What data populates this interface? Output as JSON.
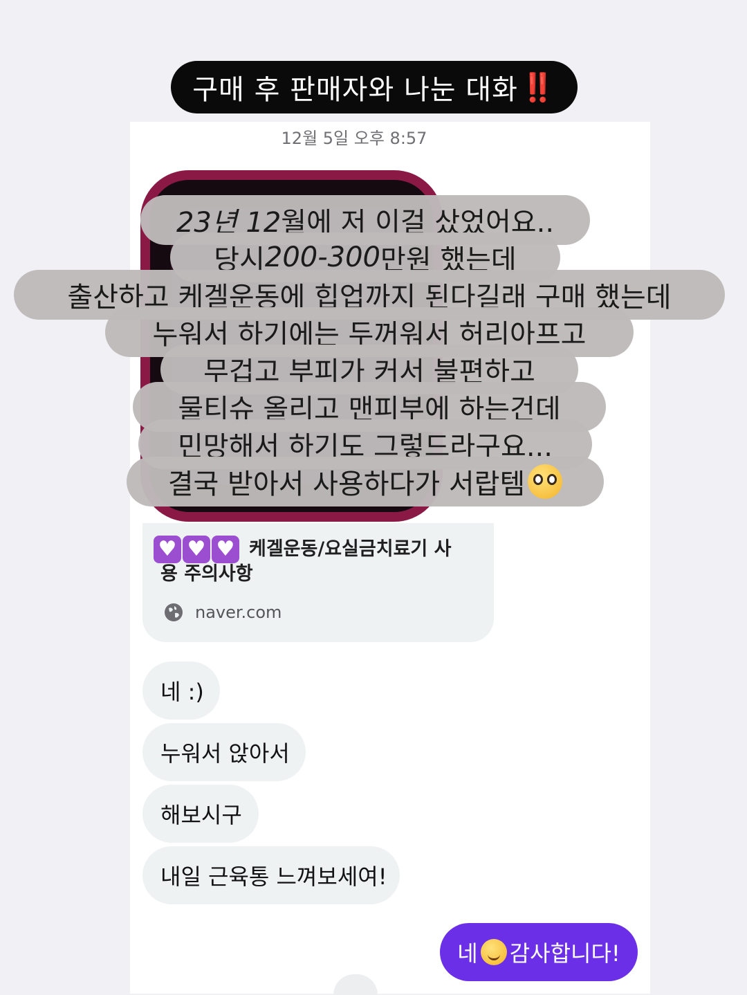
{
  "title": {
    "text": "구매 후 판매자와 나눈 대화",
    "emphasis": "‼️"
  },
  "timestamp": "12월 5일 오후 8:57",
  "overlay_lines": [
    {
      "pre": "",
      "italic": "23년 12",
      "post": "월에 저 이걸 샀었어요.."
    },
    {
      "pre": "당시 ",
      "italic": "200-300",
      "post": "만원 했는데"
    },
    {
      "pre": "출산하고 케겔운동에 힙업까지 된다길래 구매 했는데",
      "italic": "",
      "post": ""
    },
    {
      "pre": "누워서 하기에는 두꺼워서 허리아프고",
      "italic": "",
      "post": ""
    },
    {
      "pre": "무겁고 부피가 커서 불편하고",
      "italic": "",
      "post": ""
    },
    {
      "pre": "물티슈 올리고 맨피부에 하는건데",
      "italic": "",
      "post": ""
    },
    {
      "pre": "민망해서 하기도 그렇드라구요...",
      "italic": "",
      "post": ""
    },
    {
      "pre": "결국 받아서 사용하다가 서랍템",
      "italic": "",
      "post": "",
      "emoji": "pleading-face-emoji"
    }
  ],
  "link_card": {
    "hearts_icon": "purple-heart-emoji",
    "title": "케겔운동/요실금치료기 사용 주의사항",
    "domain": "naver.com"
  },
  "received_messages": [
    "네 :)",
    "누워서 앉아서",
    "해보시구",
    "내일 근육통 느껴보세여!"
  ],
  "sent_message": {
    "before": "네",
    "emoji": "smiling-face-emoji",
    "after": "감사합니다!"
  },
  "colors": {
    "title_bg": "#0a0a0a",
    "sent_bubble": "#6b2fe8",
    "received_bubble": "#eff2f3",
    "overlay_bg": "#bebaba"
  }
}
